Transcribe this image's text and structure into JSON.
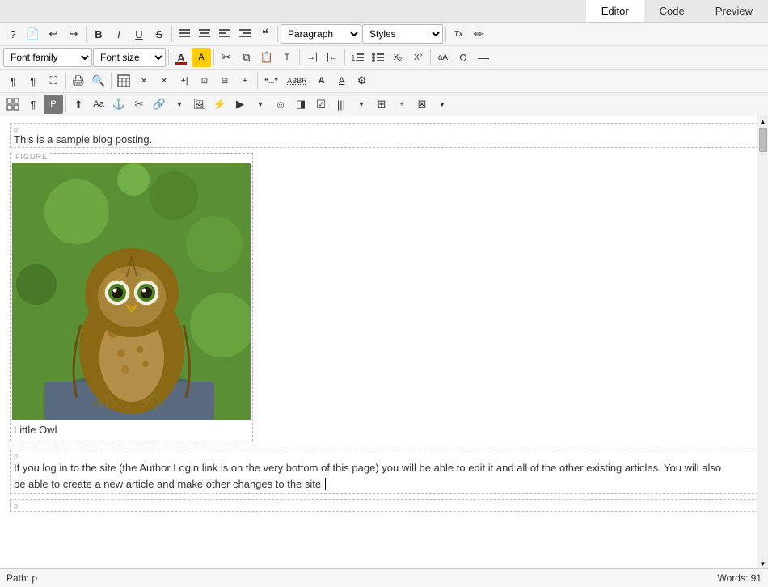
{
  "tabs": [
    {
      "id": "editor",
      "label": "Editor",
      "active": true
    },
    {
      "id": "code",
      "label": "Code",
      "active": false
    },
    {
      "id": "preview",
      "label": "Preview",
      "active": false
    }
  ],
  "toolbar": {
    "row1": {
      "buttons": [
        {
          "id": "help",
          "symbol": "?",
          "title": "Help"
        },
        {
          "id": "new-doc",
          "symbol": "📄",
          "title": "New Document"
        },
        {
          "id": "undo",
          "symbol": "↩",
          "title": "Undo"
        },
        {
          "id": "redo",
          "symbol": "↪",
          "title": "Redo"
        },
        {
          "id": "bold",
          "symbol": "B",
          "title": "Bold",
          "class": "bold"
        },
        {
          "id": "italic",
          "symbol": "I",
          "title": "Italic",
          "class": "italic"
        },
        {
          "id": "underline",
          "symbol": "U",
          "title": "Underline",
          "class": "underline"
        },
        {
          "id": "strikethrough",
          "symbol": "S",
          "title": "Strikethrough",
          "class": "strike"
        },
        {
          "id": "align-justify",
          "symbol": "≡",
          "title": "Justify"
        },
        {
          "id": "align-center",
          "symbol": "≡",
          "title": "Center"
        },
        {
          "id": "align-left",
          "symbol": "≡",
          "title": "Left"
        },
        {
          "id": "align-right",
          "symbol": "≡",
          "title": "Right"
        },
        {
          "id": "blockquote",
          "symbol": "❝",
          "title": "Blockquote"
        }
      ],
      "selects": [
        {
          "id": "paragraph-format",
          "value": "Paragraph",
          "class": "paragraph-select"
        },
        {
          "id": "styles",
          "value": "Styles",
          "class": "styles-select"
        }
      ],
      "right_buttons": [
        {
          "id": "source",
          "symbol": "Tx",
          "title": "Source"
        },
        {
          "id": "eraser",
          "symbol": "✏",
          "title": "Erase"
        }
      ]
    },
    "row2": {
      "selects": [
        {
          "id": "font-family",
          "value": "Font family",
          "class": "font-family-select"
        },
        {
          "id": "font-size",
          "value": "Font size",
          "class": "font-size-select"
        }
      ],
      "buttons": [
        {
          "id": "font-color",
          "symbol": "A",
          "title": "Font Color",
          "color": "red"
        },
        {
          "id": "highlight-color",
          "symbol": "A",
          "title": "Highlight Color",
          "color": "yellow"
        },
        {
          "id": "cut",
          "symbol": "✂",
          "title": "Cut"
        },
        {
          "id": "copy",
          "symbol": "⧉",
          "title": "Copy"
        },
        {
          "id": "paste",
          "symbol": "📋",
          "title": "Paste"
        },
        {
          "id": "paste-text",
          "symbol": "T",
          "title": "Paste as Text"
        },
        {
          "id": "indent-increase",
          "symbol": "→|",
          "title": "Increase Indent"
        },
        {
          "id": "indent-decrease",
          "symbol": "|←",
          "title": "Decrease Indent"
        },
        {
          "id": "list-ordered",
          "symbol": "1.",
          "title": "Ordered List"
        },
        {
          "id": "list-unordered",
          "symbol": "•",
          "title": "Unordered List"
        },
        {
          "id": "subscript",
          "symbol": "X₂",
          "title": "Subscript"
        },
        {
          "id": "superscript",
          "symbol": "X²",
          "title": "Superscript"
        },
        {
          "id": "special-chars",
          "symbol": "Aa",
          "title": "Special Characters"
        },
        {
          "id": "omega",
          "symbol": "Ω",
          "title": "Omega/Special"
        },
        {
          "id": "hr",
          "symbol": "—",
          "title": "Horizontal Rule"
        }
      ]
    },
    "row3": {
      "buttons": [
        {
          "id": "para-mark",
          "symbol": "¶",
          "title": "Show Blocks"
        },
        {
          "id": "pilcrow",
          "symbol": "¶",
          "title": "Show Paragraph"
        },
        {
          "id": "fullscreen",
          "symbol": "⛶",
          "title": "Fullscreen"
        },
        {
          "id": "print",
          "symbol": "🖨",
          "title": "Print"
        },
        {
          "id": "find",
          "symbol": "🔍",
          "title": "Find"
        },
        {
          "id": "table",
          "symbol": "⊞",
          "title": "Insert Table"
        },
        {
          "id": "del-col",
          "symbol": "✕",
          "title": "Delete Column"
        },
        {
          "id": "del-row",
          "symbol": "✕",
          "title": "Delete Row"
        },
        {
          "id": "insert-col",
          "symbol": "+|",
          "title": "Insert Column"
        },
        {
          "id": "merge-cell",
          "symbol": "⊡",
          "title": "Merge Cells"
        },
        {
          "id": "split-cell",
          "symbol": "⊟",
          "title": "Split Cell"
        },
        {
          "id": "insert-row",
          "symbol": "+",
          "title": "Insert Row"
        },
        {
          "id": "quote",
          "symbol": "\"...\"",
          "title": "Quote"
        },
        {
          "id": "abbr",
          "symbol": "ABBR",
          "title": "Abbreviation"
        },
        {
          "id": "format",
          "symbol": "A",
          "title": "Format"
        },
        {
          "id": "format2",
          "symbol": "A",
          "title": "Format2"
        },
        {
          "id": "settings",
          "symbol": "⚙",
          "title": "Settings"
        }
      ]
    },
    "row4": {
      "buttons": [
        {
          "id": "grid",
          "symbol": "⊞",
          "title": "Grid"
        },
        {
          "id": "pilcrow2",
          "symbol": "¶",
          "title": "Pilcrow"
        },
        {
          "id": "p-btn",
          "symbol": "P",
          "title": "P button"
        },
        {
          "id": "upload",
          "symbol": "↑",
          "title": "Upload"
        },
        {
          "id": "font-size2",
          "symbol": "Aa",
          "title": "Font Size"
        },
        {
          "id": "anchor",
          "symbol": "⚓",
          "title": "Anchor"
        },
        {
          "id": "special",
          "symbol": "✂",
          "title": "Special"
        },
        {
          "id": "link",
          "symbol": "🔗",
          "title": "Link"
        },
        {
          "id": "image",
          "symbol": "🖼",
          "title": "Image"
        },
        {
          "id": "flash",
          "symbol": "⚡",
          "title": "Flash"
        },
        {
          "id": "media",
          "symbol": "▶",
          "title": "Media"
        },
        {
          "id": "smiley",
          "symbol": "☺",
          "title": "Smiley"
        },
        {
          "id": "color-picker",
          "symbol": "◨",
          "title": "Color Picker"
        },
        {
          "id": "select",
          "symbol": "☑",
          "title": "Select"
        },
        {
          "id": "columns",
          "symbol": "|||",
          "title": "Columns"
        },
        {
          "id": "layout",
          "symbol": "⊞",
          "title": "Layout"
        },
        {
          "id": "more",
          "symbol": "⊠",
          "title": "More"
        }
      ]
    }
  },
  "editor": {
    "path_label": "Path:",
    "path_value": "p",
    "words_label": "Words:",
    "words_count": "91",
    "p_label": "p",
    "sample_text": "This is a sample blog posting.",
    "figure_label": "FIGURE",
    "figure_caption": "Little Owl",
    "content_p1_label": "p",
    "content_p1": "If you log in to the site (the Author Login link is on the very bottom of this page) you will be able to edit it and all of the other existing articles. You will also be able to create a new article and make other changes to the site",
    "content_p2_label": "p",
    "content_p2": ""
  }
}
